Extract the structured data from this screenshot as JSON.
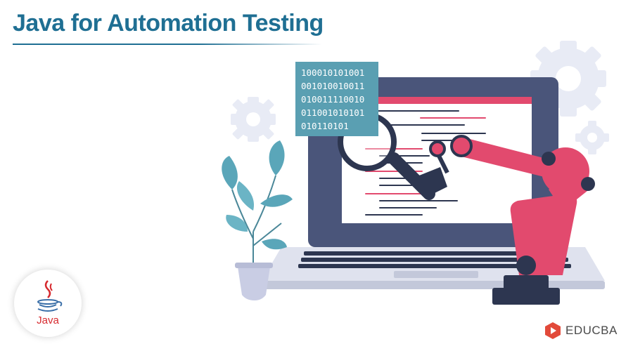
{
  "header": {
    "title": "Java for Automation Testing"
  },
  "binary": {
    "lines": [
      "100010101001",
      "001010010011",
      "010011110010",
      "011001010101",
      "010110101"
    ]
  },
  "logo": {
    "java_label": "Java",
    "brand_label": "EDUCBA"
  },
  "colors": {
    "title": "#1f6f93",
    "laptop_frame": "#4a557a",
    "robot_arm": "#e24a6e",
    "plant": "#5aa6b9",
    "gear": "#e8ebf5",
    "java_red": "#d6292e",
    "java_blue": "#3a6fa8"
  },
  "icons": [
    "gear-icon",
    "magnifier-icon",
    "robot-arm-icon",
    "plant-icon",
    "laptop-icon",
    "java-logo-icon",
    "educba-logo-icon"
  ]
}
